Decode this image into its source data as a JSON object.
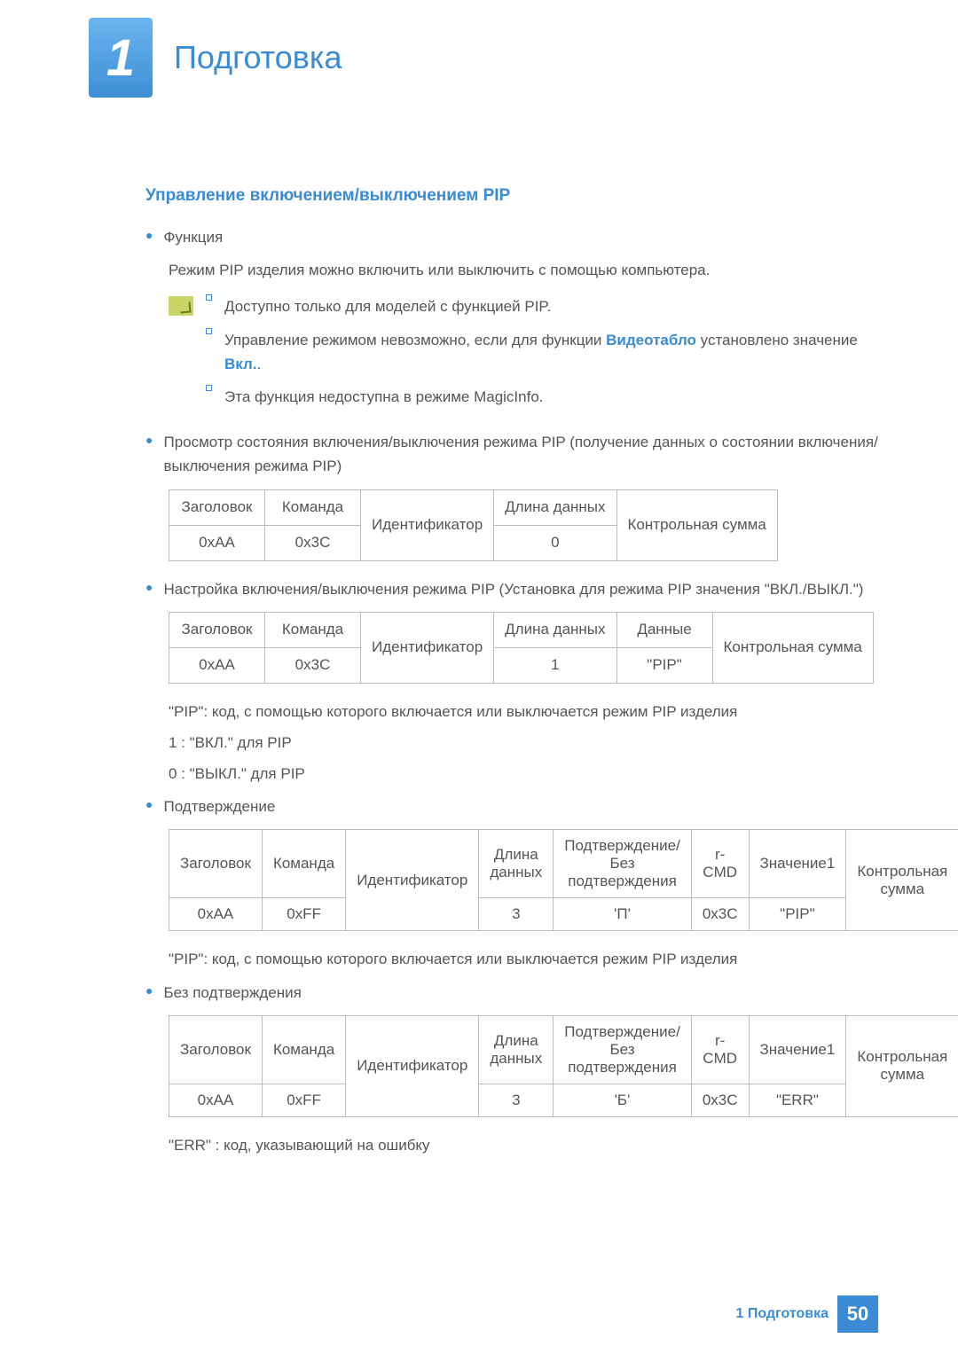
{
  "chapter": {
    "num": "1",
    "title": "Подготовка"
  },
  "section": {
    "title": "Управление включением/выключением PIP"
  },
  "func": {
    "label": "Функция",
    "desc": "Режим PIP изделия можно включить или выключить с помощью компьютера."
  },
  "notes": {
    "n1": "Доступно только для моделей с функцией PIP.",
    "n2a": "Управление режимом невозможно, если для функции ",
    "n2b": "Видеотабло",
    "n2c": " установлено значение ",
    "n2d": "Вкл.",
    "n2e": ".",
    "n3": "Эта функция недоступна в режиме MagicInfo."
  },
  "status": {
    "title": "Просмотр состояния включения/выключения режима PIP (получение данных о состоянии включения/выключения режима PIP)"
  },
  "table1": {
    "h1": "Заголовок",
    "h2": "Команда",
    "h3": "Идентификатор",
    "h4": "Длина данных",
    "h5": "Контрольная сумма",
    "r1": "0xAA",
    "r2": "0x3C",
    "r3": "0"
  },
  "set": {
    "title": "Настройка включения/выключения режима PIP (Установка для режима PIP значения \"ВКЛ./ВЫКЛ.\")"
  },
  "table2": {
    "h1": "Заголовок",
    "h2": "Команда",
    "h3": "Идентификатор",
    "h4": "Длина данных",
    "h5": "Данные",
    "h6": "Контрольная сумма",
    "r1": "0xAA",
    "r2": "0x3C",
    "r3": "1",
    "r4": "\"PIP\""
  },
  "pip_desc": "\"PIP\": код, с помощью которого включается или выключается режим PIP изделия",
  "pip_on": "1 : \"ВКЛ.\" для PIP",
  "pip_off": "0 : \"ВЫКЛ.\" для PIP",
  "ack": {
    "label": "Подтверждение"
  },
  "table3": {
    "h1": "Заголовок",
    "h2": "Команда",
    "h3": "Идентификатор",
    "h4": "Длина данных",
    "h5": "Подтверждение/Без подтверждения",
    "h6": "r-CMD",
    "h7": "Значение1",
    "h8": "Контрольная сумма",
    "r1": "0xAA",
    "r2": "0xFF",
    "r3": "3",
    "r4": "'П'",
    "r5": "0x3C",
    "r6": "\"PIP\""
  },
  "pip_desc2": "\"PIP\": код, с помощью которого включается или выключается режим PIP изделия",
  "nak": {
    "label": "Без подтверждения"
  },
  "table4": {
    "h1": "Заголовок",
    "h2": "Команда",
    "h3": "Идентификатор",
    "h4": "Длина данных",
    "h5": "Подтверждение/Без подтверждения",
    "h6": "r-CMD",
    "h7": "Значение1",
    "h8": "Контрольная сумма",
    "r1": "0xAA",
    "r2": "0xFF",
    "r3": "3",
    "r4": "'Б'",
    "r5": "0x3C",
    "r6": "\"ERR\""
  },
  "err_desc": "\"ERR\" : код, указывающий на ошибку",
  "footer": {
    "text": "1 Подготовка",
    "page": "50"
  }
}
